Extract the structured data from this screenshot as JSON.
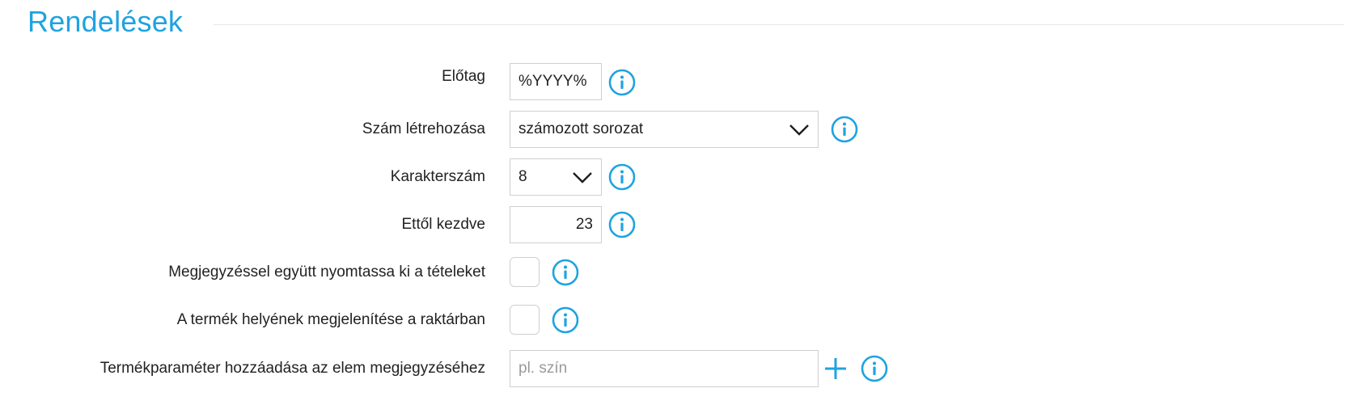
{
  "section": {
    "title": "Rendelések"
  },
  "rows": {
    "prefix": {
      "label": "Előtag",
      "value": "%YYYY%"
    },
    "number_generation": {
      "label": "Szám létrehozása",
      "selected": "számozott sorozat"
    },
    "char_count": {
      "label": "Karakterszám",
      "selected": "8"
    },
    "start_from": {
      "label": "Ettől kezdve",
      "value": "23"
    },
    "print_items_with_note": {
      "label": "Megjegyzéssel együtt nyomtassa ki a tételeket",
      "checked": false
    },
    "show_product_location": {
      "label": "A termék helyének megjelenítése a raktárban",
      "checked": false
    },
    "product_param": {
      "label": "Termékparaméter hozzáadása az elem megjegyzéséhez",
      "placeholder": "pl. szín",
      "value": ""
    }
  },
  "icons": {
    "info": "info-circle-icon",
    "dropdown": "chevron-down-icon",
    "add": "plus-icon"
  },
  "colors": {
    "accent": "#1fa3e0",
    "border": "#cfcfcf",
    "text": "#222222"
  }
}
